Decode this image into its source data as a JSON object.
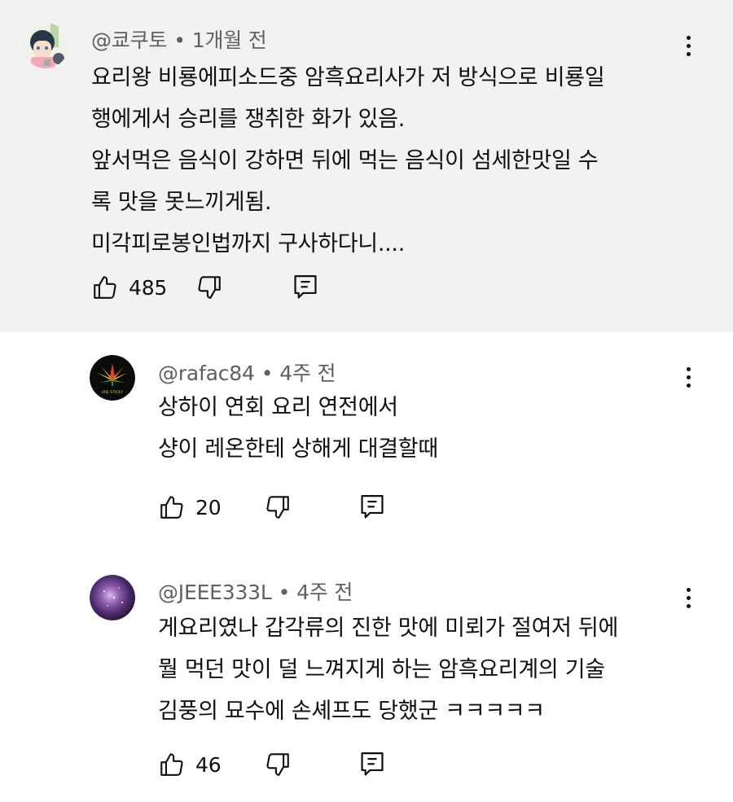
{
  "comments": [
    {
      "handle": "@쿄쿠토",
      "time": "1개월 전",
      "lines": [
        "요리왕 비룡에피소드중 암흑요리사가 저 방식으로 비룡일",
        "행에게서 승리를 쟁취한 화가 있음.",
        "앞서먹은 음식이 강하면 뒤에 먹는 음식이 섬세한맛일 수",
        "록 맛을 못느끼게됨.",
        "미각피로봉인법까지 구사하다니...."
      ],
      "likes": "485",
      "avatar": "anime-girl-avatar",
      "highlighted": true
    },
    {
      "handle": "@rafac84",
      "time": "4주 전",
      "lines": [
        "상하이 연회 요리 연전에서",
        "샹이 레온한테 상해게 대결할때"
      ],
      "likes": "20",
      "avatar": "leaf-logo-avatar",
      "avatar_caption": "IRIE STICKY",
      "highlighted": false
    },
    {
      "handle": "@JEEE333L",
      "time": "4주 전",
      "lines": [
        "게요리였나 갑각류의 진한 맛에 미뢰가 절여저 뒤에",
        "뭘 먹던 맛이 덜 느껴지게 하는 암흑요리계의 기술",
        "김풍의 묘수에 손셰프도 당했군 ㅋㅋㅋㅋㅋ"
      ],
      "likes": "46",
      "avatar": "galaxy-avatar",
      "highlighted": false
    }
  ],
  "icons": {
    "like": "thumbs-up-icon",
    "dislike": "thumbs-down-icon",
    "reply": "reply-icon",
    "more": "more-vertical-icon"
  },
  "colors": {
    "highlight_bg": "#f2f2f2",
    "meta_text": "#606060",
    "text": "#0f0f0f"
  }
}
